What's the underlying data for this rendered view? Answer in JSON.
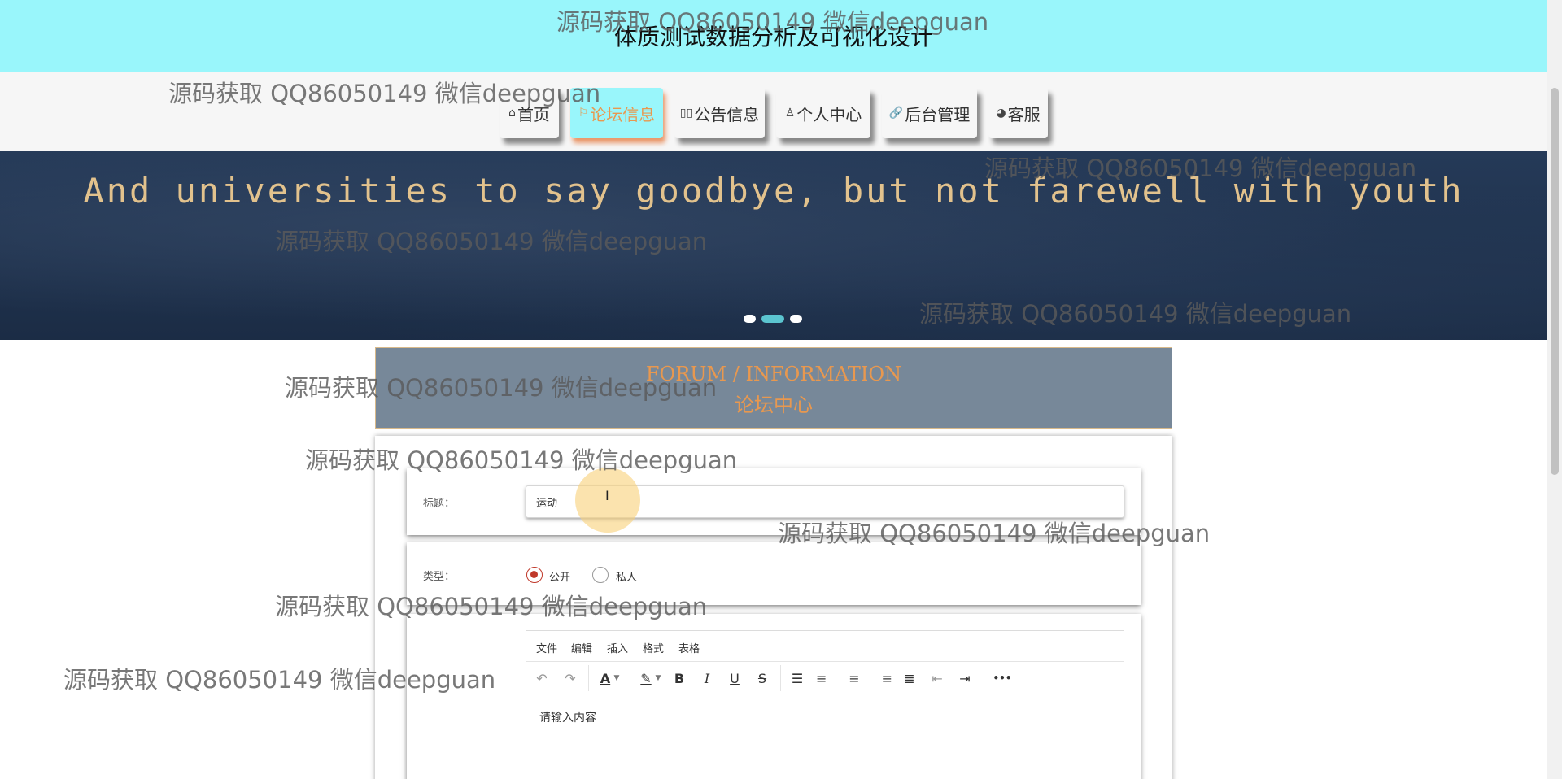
{
  "header": {
    "title": "体质测试数据分析及可视化设计"
  },
  "nav": {
    "items": [
      {
        "icon": "⌂",
        "label": "首页"
      },
      {
        "icon": "⚐",
        "label": "论坛信息"
      },
      {
        "icon": "▯▯",
        "label": "公告信息"
      },
      {
        "icon": "♙",
        "label": "个人中心"
      },
      {
        "icon": "🔗",
        "label": "后台管理"
      },
      {
        "icon": "◕",
        "label": "客服"
      }
    ],
    "active_index": 1
  },
  "banner": {
    "text": "And universities to say goodbye, but not farewell with youth"
  },
  "section": {
    "title_en": "FORUM / INFORMATION",
    "title_zh": "论坛中心"
  },
  "form": {
    "title_label": "标题：",
    "title_value": "运动",
    "type_label": "类型：",
    "type_options": [
      "公开",
      "私人"
    ],
    "type_selected": "公开"
  },
  "editor": {
    "menu": [
      "文件",
      "编辑",
      "插入",
      "格式",
      "表格"
    ],
    "placeholder": "请输入内容",
    "tools": {
      "undo": "↶",
      "redo": "↷",
      "font_color": "A",
      "highlight": "✎",
      "bold": "B",
      "italic": "I",
      "underline": "U",
      "strike": "S",
      "line_height": "☰",
      "align_left": "≡",
      "align_center": "≡",
      "align_right": "≡",
      "justify": "≣",
      "outdent": "⇤",
      "indent": "⇥",
      "more": "•••"
    }
  },
  "watermark": "源码获取 QQ86050149 微信deepguan",
  "colors": {
    "header_bg": "#99f6fb",
    "accent_orange": "#e8984f",
    "section_bg": "#778899",
    "radio_red": "#c0392b"
  }
}
